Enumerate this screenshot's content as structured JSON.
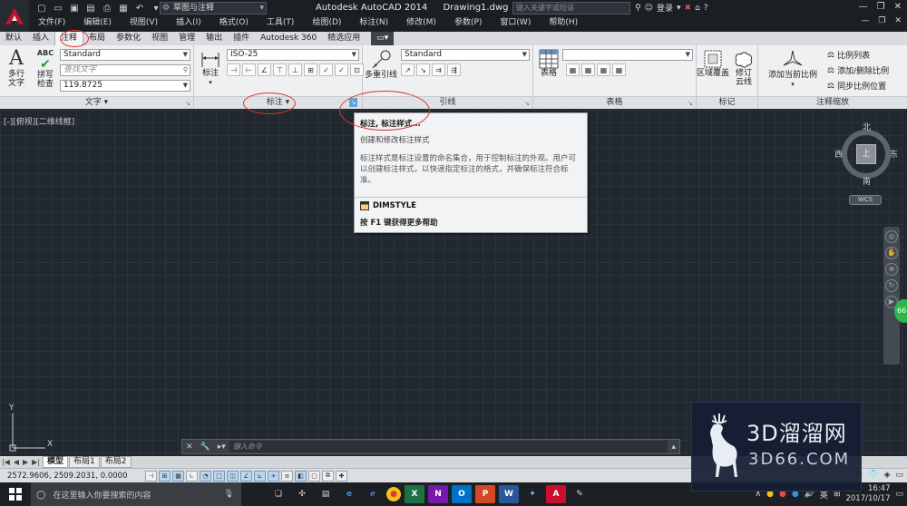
{
  "titlebar": {
    "workspace": "草图与注释",
    "app_name": "Autodesk AutoCAD 2014",
    "document": "Drawing1.dwg",
    "search_placeholder": "键入关键字或短语",
    "signin": "登录"
  },
  "menus": [
    "文件(F)",
    "编辑(E)",
    "视图(V)",
    "插入(I)",
    "格式(O)",
    "工具(T)",
    "绘图(D)",
    "标注(N)",
    "修改(M)",
    "参数(P)",
    "窗口(W)",
    "帮助(H)"
  ],
  "ribbon_tabs": [
    "默认",
    "插入",
    "注释",
    "布局",
    "参数化",
    "视图",
    "管理",
    "输出",
    "插件",
    "Autodesk 360",
    "精选应用"
  ],
  "ribbon_tab_active": "注释",
  "ribbon": {
    "text_panel": {
      "title": "文字",
      "mtext_label": "多行\n文字",
      "spell_label": "拼写\n检查",
      "spell_abc": "ABC",
      "style": "Standard",
      "find_placeholder": "查找文字",
      "height": "119.8725"
    },
    "dim_panel": {
      "title": "标注",
      "dim_label": "标注",
      "style": "ISO-25"
    },
    "leader_panel": {
      "title": "引线",
      "mleader_label": "多重引线",
      "style": "Standard"
    },
    "table_panel": {
      "title": "表格",
      "table_label": "表格"
    },
    "markup_panel": {
      "title": "标记",
      "wipeout_label": "区域覆盖",
      "revcloud_label": "修订\n云线"
    },
    "scale_panel": {
      "title": "注释缩放",
      "add_current_label": "添加当前比例",
      "scale_list": "比例列表",
      "add_delete": "添加/删除比例",
      "sync": "同步比例位置"
    }
  },
  "viewport": {
    "label": "[-][俯视][二维线框]"
  },
  "tooltip": {
    "title": "标注, 标注样式...",
    "subtitle": "创建和修改标注样式",
    "description": "标注样式是标注设置的命名集合，用于控制标注的外观。用户可以创建标注样式，以快速指定标注的格式，并确保标注符合标准。",
    "command": "DIMSTYLE",
    "help": "按 F1 键获得更多帮助"
  },
  "viewcube": {
    "north": "北",
    "south": "南",
    "east": "东",
    "west": "西",
    "face": "上",
    "wcs": "WCS"
  },
  "nav_badge": "66",
  "ucs": {
    "x": "X",
    "y": "Y"
  },
  "command_line": {
    "placeholder": "键入命令"
  },
  "layout_tabs": [
    "模型",
    "布局1",
    "布局2"
  ],
  "layout_active": "模型",
  "status": {
    "coords": "2572.9606, 2509.2031, 0.0000"
  },
  "taskbar": {
    "search": "在这里输入你要搜索的内容",
    "ime": "英",
    "time": "16:47",
    "date": "2017/10/17",
    "apps": [
      {
        "name": "excel",
        "glyph": "X",
        "color": "#1e7145"
      },
      {
        "name": "onenote",
        "glyph": "N",
        "color": "#7719aa"
      },
      {
        "name": "outlook",
        "glyph": "O",
        "color": "#0072c6"
      },
      {
        "name": "powerpoint",
        "glyph": "P",
        "color": "#d24726"
      },
      {
        "name": "word",
        "glyph": "W",
        "color": "#2b579a"
      }
    ]
  },
  "watermark": {
    "line1": "3D溜溜网",
    "line2": "3D66.COM"
  },
  "colors": {
    "annotation_ring": "#e03030",
    "canvas_bg": "#212830",
    "ribbon_bg": "#eef0f2",
    "autocad_red": "#c8102e"
  }
}
